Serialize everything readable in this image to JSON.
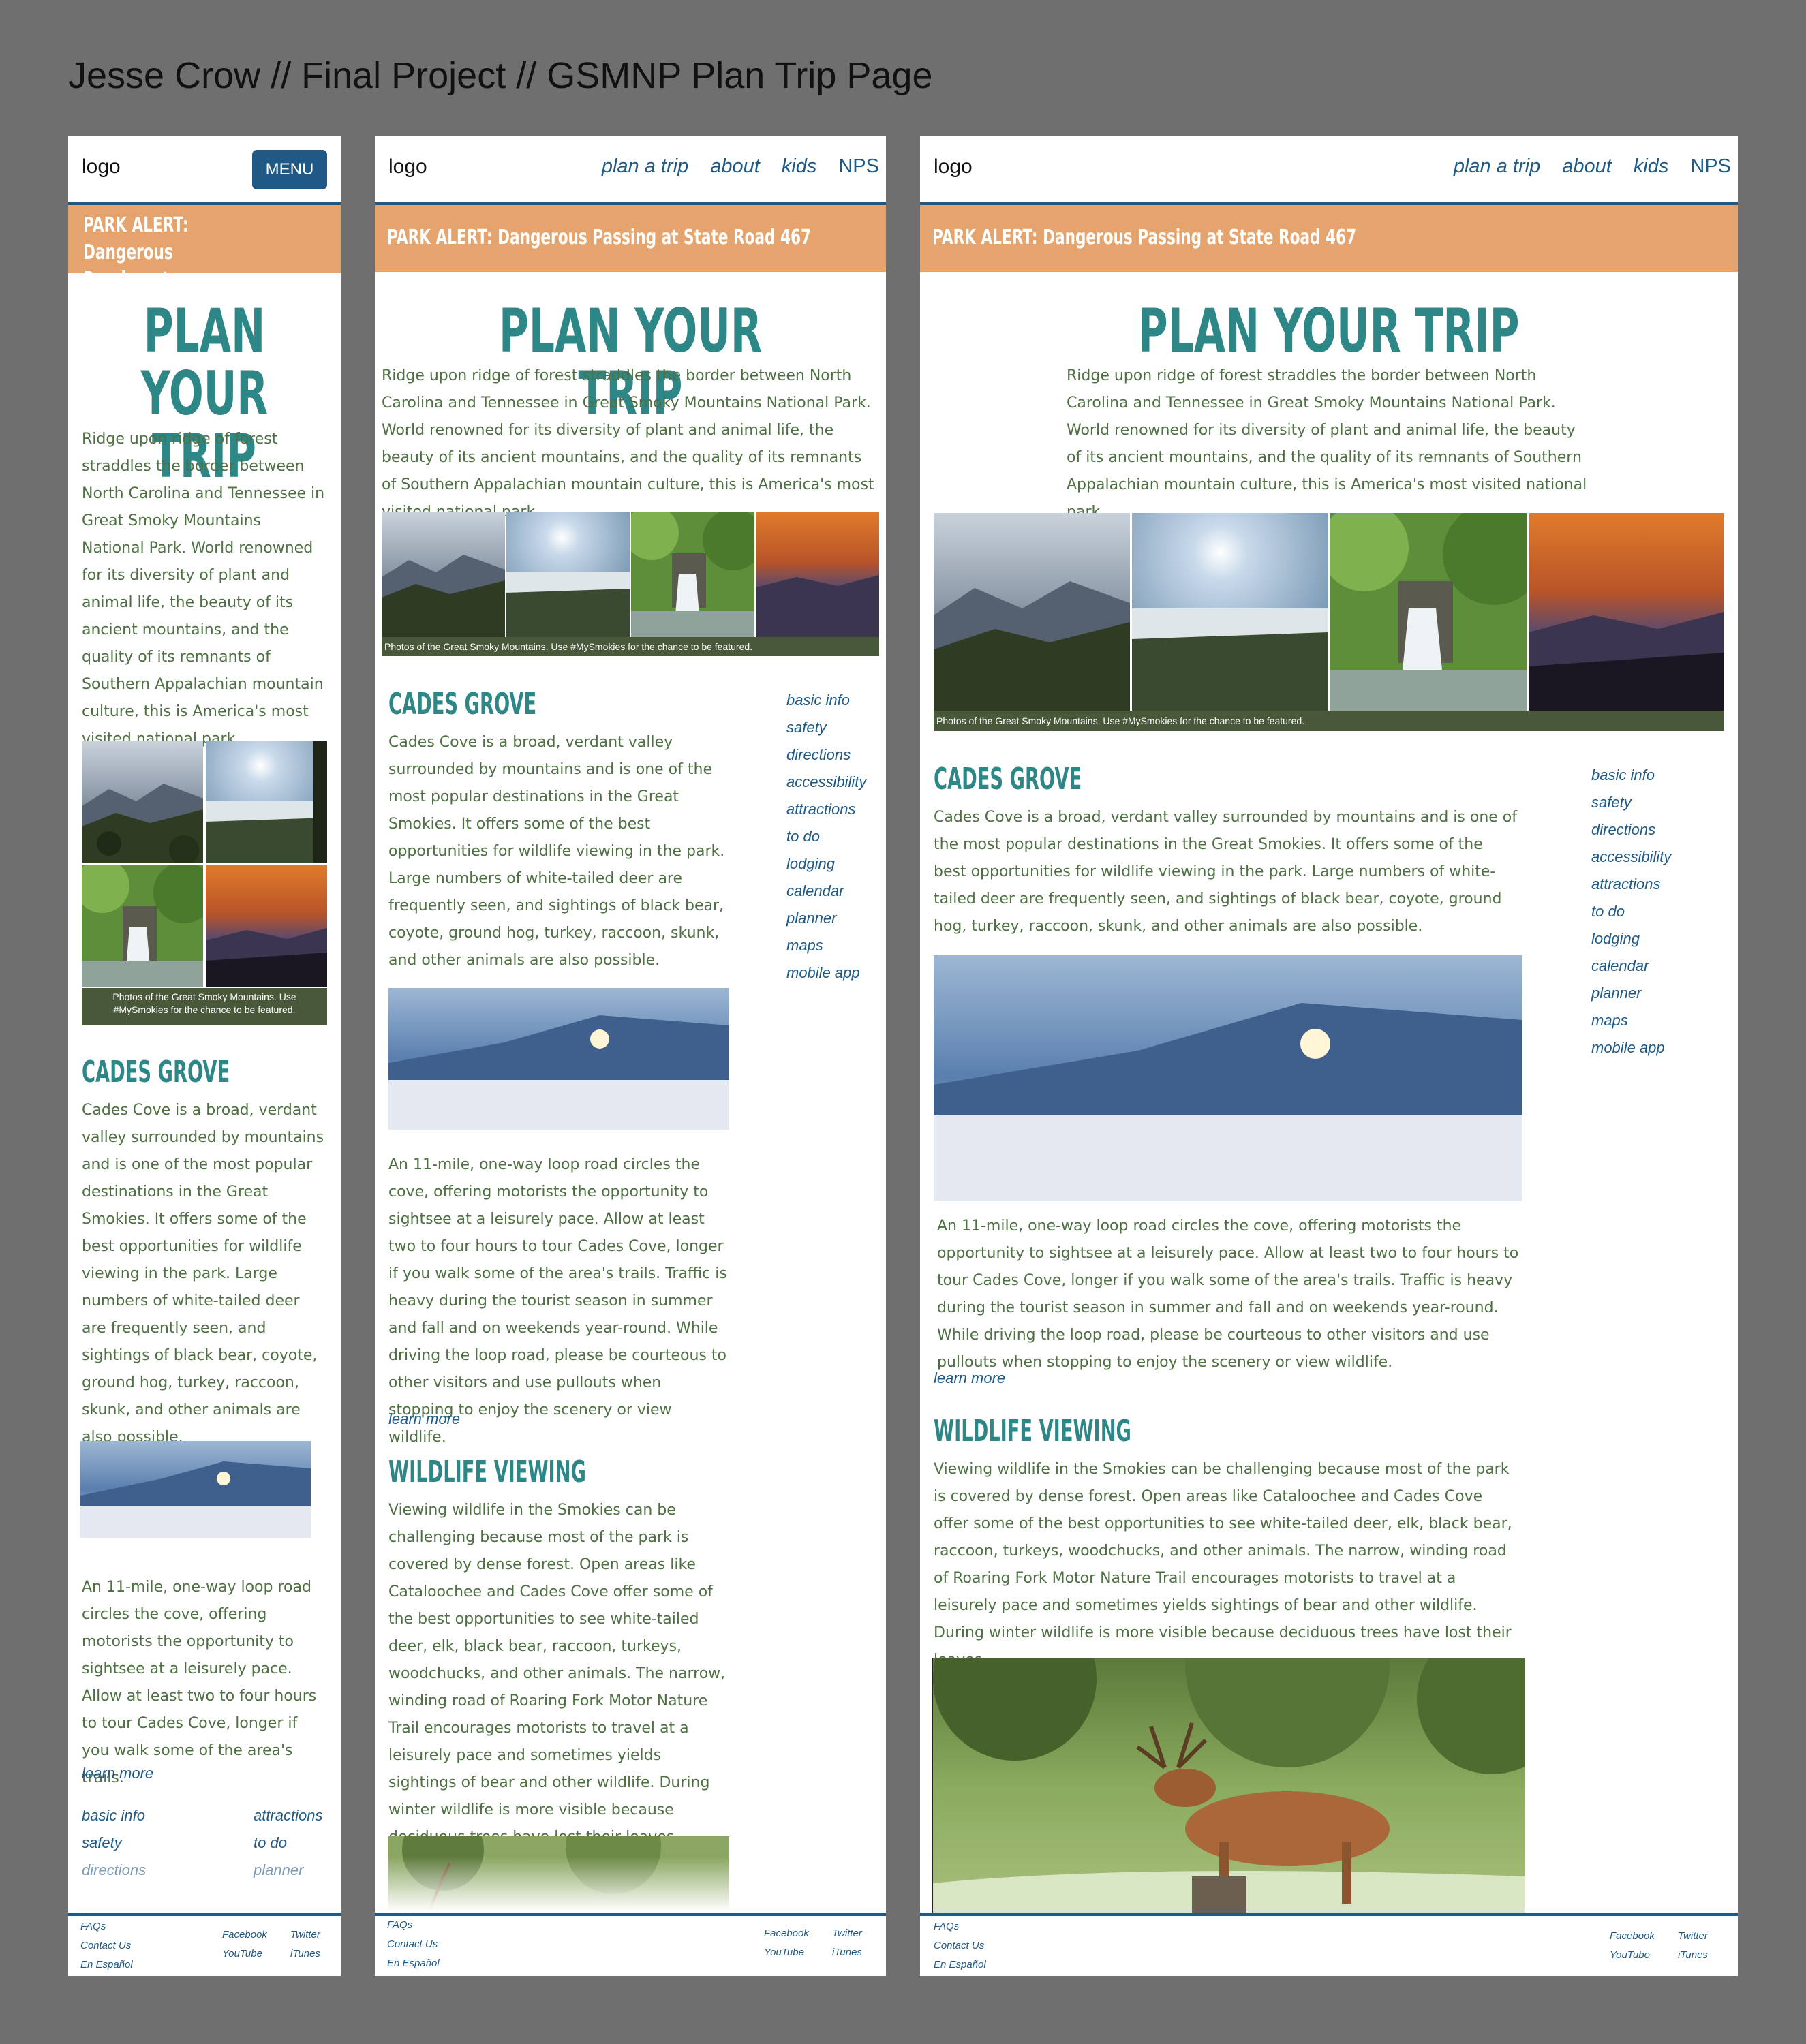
{
  "page_title": "Jesse Crow // Final Project // GSMNP Plan Trip Page",
  "logo": "logo",
  "menu_label": "MENU",
  "nav": [
    "plan a trip",
    "about",
    "kids",
    "NPS"
  ],
  "alert": "PARK ALERT: Dangerous Passing at State Road 467",
  "heading": "PLAN YOUR TRIP",
  "heading_mobile_line1": "PLAN YOUR",
  "heading_mobile_line2": "TRIP",
  "intro": "Ridge upon ridge of forest straddles the border between North Carolina and Tennessee in Great Smoky Mountains National Park. World renowned for its diversity of plant and animal life, the beauty of its ancient mountains, and the quality of its remnants of Southern Appalachian mountain culture, this is America's most visited national park.",
  "photo_caption": "Photos of the Great Smoky Mountains. Use #MySmokies for the chance to be featured.",
  "cades_heading": "CADES GROVE",
  "cades_text": "Cades Cove is a broad, verdant valley surrounded by mountains and is one of the most popular destinations in the Great Smokies. It offers some of the best opportunities for wildlife viewing in the park. Large numbers of white-tailed deer are frequently seen, and sightings of black bear, coyote, ground hog, turkey, raccoon, skunk, and other animals are also possible.",
  "loop_text": "An 11-mile, one-way loop road circles the cove, offering motorists the opportunity to sightsee at a leisurely pace. Allow at least two to four hours to tour Cades Cove, longer if you walk some of the area's trails. Traffic is heavy during the tourist season in summer and fall and on weekends year-round. While driving the loop road, please be courteous to other visitors and use pullouts when stopping to enjoy the scenery or view wildlife.",
  "loop_text_mobile": "An 11-mile, one-way loop road circles the cove, offering motorists the opportunity to sightsee at a leisurely pace. Allow at least two to four hours to tour Cades Cove, longer if you walk some of the area's trails.",
  "learn_more": "learn more",
  "wildlife_heading": "WILDLIFE VIEWING",
  "wildlife_text": "Viewing wildlife in the Smokies can be challenging because most of the park is covered by dense forest. Open areas like Cataloochee and Cades Cove offer some of the best opportunities to see white-tailed deer, elk, black bear, raccoon, turkeys, woodchucks, and other animals. The narrow, winding road of Roaring Fork Motor Nature Trail encourages motorists to travel at a leisurely pace and sometimes yields sightings of bear and other wildlife. During winter wildlife is more visible because deciduous trees have lost their leaves.",
  "side_nav": [
    "basic info",
    "safety",
    "directions",
    "accessibility",
    "attractions",
    "to do",
    "lodging",
    "calendar",
    "planner",
    "maps",
    "mobile app"
  ],
  "mobile_links_left": [
    "basic info",
    "safety",
    "directions"
  ],
  "mobile_links_right": [
    "attractions",
    "to do",
    "planner"
  ],
  "footer_left": [
    "FAQs",
    "Contact Us",
    "En Español"
  ],
  "footer_mid": [
    "Facebook",
    "YouTube"
  ],
  "footer_right": [
    "Twitter",
    "iTunes"
  ]
}
